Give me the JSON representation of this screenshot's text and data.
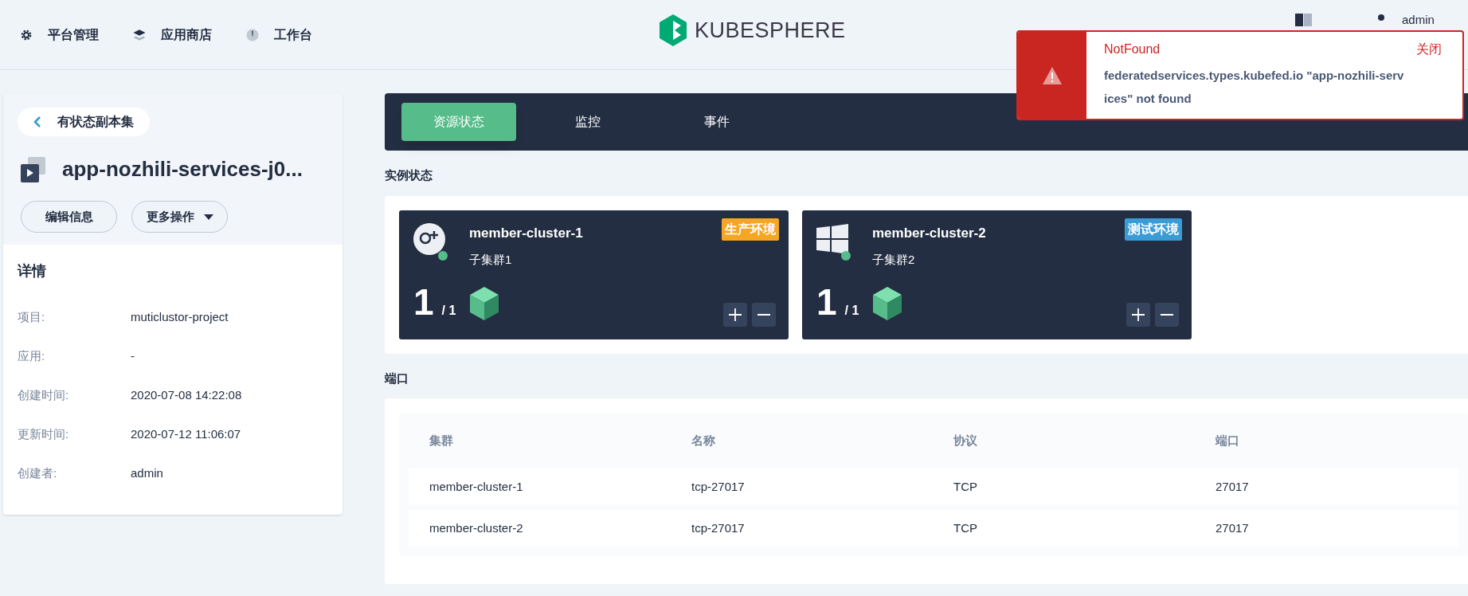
{
  "nav": {
    "items": [
      {
        "label": "平台管理",
        "kind": "gear"
      },
      {
        "label": "应用商店",
        "kind": "layers"
      },
      {
        "label": "工作台",
        "kind": "dashboard"
      }
    ],
    "logo": "KUBESPHERE",
    "user": "admin"
  },
  "notification": {
    "title": "NotFound",
    "close": "关闭",
    "message": "federatedservices.types.kubefed.io \"app-nozhili-serv\nices\" not found"
  },
  "sidebar": {
    "back": "有状态副本集",
    "title": "app-nozhili-services-j0...",
    "buttons": [
      {
        "label": "编辑信息",
        "kind": "plain"
      },
      {
        "label": "更多操作",
        "kind": "dropdown"
      }
    ],
    "details_title": "详情",
    "details": [
      {
        "label": "项目:",
        "value": "muticlustor-project"
      },
      {
        "label": "应用:",
        "value": "-"
      },
      {
        "label": "创建时间:",
        "value": "2020-07-08 14:22:08"
      },
      {
        "label": "更新时间:",
        "value": "2020-07-12 11:06:07"
      },
      {
        "label": "创建者:",
        "value": "admin"
      }
    ]
  },
  "tabs": [
    {
      "label": "资源状态",
      "selected": true
    },
    {
      "label": "监控",
      "selected": false
    },
    {
      "label": "事件",
      "selected": false
    }
  ],
  "instances": {
    "title": "实例状态",
    "clusters": [
      {
        "name": "member-cluster-1",
        "alias": "子集群1",
        "env": "生产环境",
        "color": "#f5a623",
        "kind": "gplus",
        "ready": "1",
        "total": "/ 1"
      },
      {
        "name": "member-cluster-2",
        "alias": "子集群2",
        "env": "测试环境",
        "color": "#3a9bd5",
        "kind": "windows",
        "ready": "1",
        "total": "/ 1"
      }
    ]
  },
  "ports": {
    "title": "端口",
    "columns": [
      "集群",
      "名称",
      "协议",
      "端口"
    ],
    "rows": [
      [
        "member-cluster-1",
        "tcp-27017",
        "TCP",
        "27017"
      ],
      [
        "member-cluster-2",
        "tcp-27017",
        "TCP",
        "27017"
      ]
    ]
  }
}
